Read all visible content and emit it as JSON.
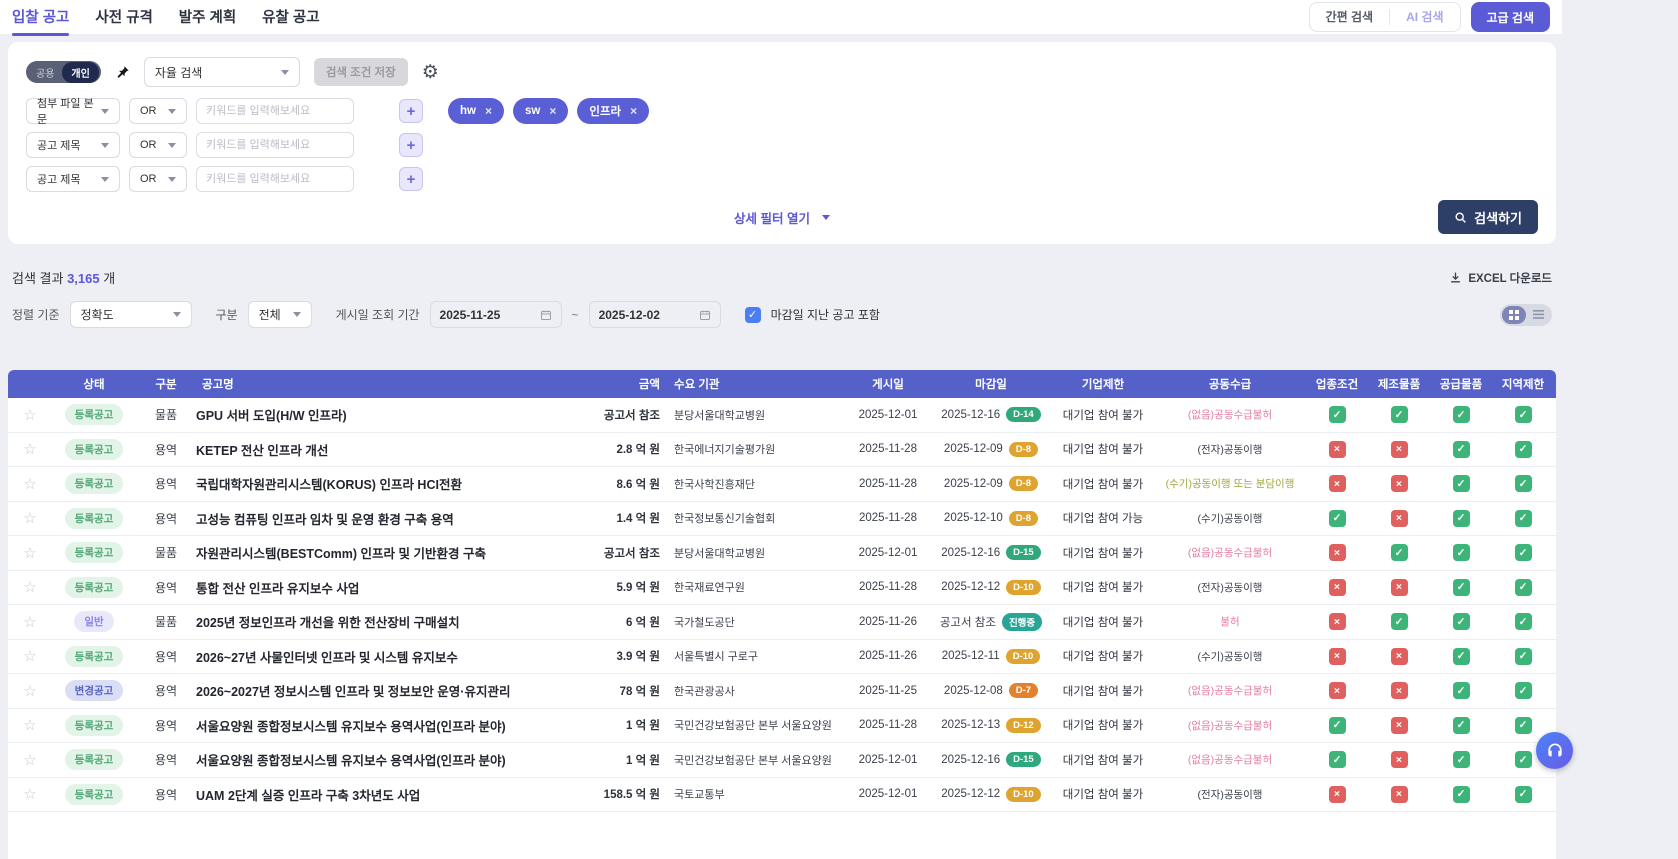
{
  "colors": {
    "accent_purple": "#5b5bd6",
    "table_header": "#5560c8",
    "navy_button": "#2d3f66",
    "flag_yes_green": "#3db578",
    "flag_no_red": "#e05f5f",
    "dday_green": "#2fa87c",
    "dday_amber": "#dfa32f",
    "dday_orange": "#e2822f",
    "dday_teal": "#27a596",
    "joint_pink": "#e77d9e",
    "joint_olive": "#a0a83c"
  },
  "nav": {
    "tabs": [
      {
        "label": "입찰 공고",
        "active": true
      },
      {
        "label": "사전 규격",
        "active": false
      },
      {
        "label": "발주 계획",
        "active": false
      },
      {
        "label": "유찰 공고",
        "active": false
      }
    ],
    "simple_search": "간편 검색",
    "ai_search": "AI 검색",
    "advanced_search": "고급 검색"
  },
  "search": {
    "scope_toggle": {
      "left": "공용",
      "right": "개인",
      "selected": "개인"
    },
    "preset_select": "자율 검색",
    "save_button": "검색 조건 저장",
    "rows": [
      {
        "field": "첨부 파일 본문",
        "operator": "OR",
        "placeholder": "키워드를 입력해보세요",
        "value": ""
      },
      {
        "field": "공고 제목",
        "operator": "OR",
        "placeholder": "키워드를 입력해보세요",
        "value": ""
      },
      {
        "field": "공고 제목",
        "operator": "OR",
        "placeholder": "키워드를 입력해보세요",
        "value": ""
      }
    ],
    "tags": [
      "hw",
      "sw",
      "인프라"
    ],
    "detail_filter_toggle": "상세 필터 열기",
    "search_button": "검색하기"
  },
  "results": {
    "count_prefix": "검색 결과",
    "count": "3,165",
    "count_suffix": "개",
    "excel_button": "EXCEL 다운로드",
    "sort_label": "정렬 기준",
    "sort_value": "정확도",
    "type_label": "구분",
    "type_value": "전체",
    "period_label": "게시일 조회 기간",
    "date_from": "2025-11-25",
    "date_separator": "~",
    "date_to": "2025-12-02",
    "include_expired_label": "마감일 지난 공고 포함",
    "include_expired_checked": true
  },
  "table": {
    "columns": [
      "상태",
      "구분",
      "공고명",
      "금액",
      "수요 기관",
      "게시일",
      "마감일",
      "기업제한",
      "공동수급",
      "업종조건",
      "제조물품",
      "공급물품",
      "지역제한"
    ],
    "rows": [
      {
        "status": "등록공고",
        "status_type": "reg",
        "category": "물품",
        "title": "GPU 서버 도입(H/W 인프라)",
        "amount": "공고서 참조",
        "org": "분당서울대학교병원",
        "posted": "2025-12-01",
        "deadline": "2025-12-16",
        "dday": "D-14",
        "dday_type": "green",
        "limit": "대기업 참여 불가",
        "joint": "(없음)공동수급불허",
        "joint_type": "pink",
        "flags": [
          true,
          true,
          true,
          true
        ]
      },
      {
        "status": "등록공고",
        "status_type": "reg",
        "category": "용역",
        "title": "KETEP 전산 인프라 개선",
        "amount": "2.8 억 원",
        "org": "한국에너지기술평가원",
        "posted": "2025-11-28",
        "deadline": "2025-12-09",
        "dday": "D-8",
        "dday_type": "amber",
        "limit": "대기업 참여 불가",
        "joint": "(전자)공동이행",
        "joint_type": "normal",
        "flags": [
          false,
          false,
          true,
          true
        ]
      },
      {
        "status": "등록공고",
        "status_type": "reg",
        "category": "용역",
        "title": "국립대학자원관리시스템(KORUS) 인프라 HCI전환",
        "amount": "8.6 억 원",
        "org": "한국사학진흥재단",
        "posted": "2025-11-28",
        "deadline": "2025-12-09",
        "dday": "D-8",
        "dday_type": "amber",
        "limit": "대기업 참여 불가",
        "joint": "(수기)공동이행 또는 분담이행",
        "joint_type": "olive",
        "flags": [
          false,
          false,
          true,
          true
        ]
      },
      {
        "status": "등록공고",
        "status_type": "reg",
        "category": "용역",
        "title": "고성능 컴퓨팅 인프라 임차 및 운영 환경 구축 용역",
        "amount": "1.4 억 원",
        "org": "한국정보통신기술협회",
        "posted": "2025-11-28",
        "deadline": "2025-12-10",
        "dday": "D-8",
        "dday_type": "amber",
        "limit": "대기업 참여 가능",
        "joint": "(수기)공동이행",
        "joint_type": "normal",
        "flags": [
          true,
          false,
          true,
          true
        ]
      },
      {
        "status": "등록공고",
        "status_type": "reg",
        "category": "물품",
        "title": "자원관리시스템(BESTComm) 인프라 및 기반환경 구축",
        "amount": "공고서 참조",
        "org": "분당서울대학교병원",
        "posted": "2025-12-01",
        "deadline": "2025-12-16",
        "dday": "D-15",
        "dday_type": "green",
        "limit": "대기업 참여 불가",
        "joint": "(없음)공동수급불허",
        "joint_type": "pink",
        "flags": [
          false,
          true,
          true,
          true
        ]
      },
      {
        "status": "등록공고",
        "status_type": "reg",
        "category": "용역",
        "title": "통합 전산 인프라 유지보수 사업",
        "amount": "5.9 억 원",
        "org": "한국재료연구원",
        "posted": "2025-11-28",
        "deadline": "2025-12-12",
        "dday": "D-10",
        "dday_type": "amber",
        "limit": "대기업 참여 불가",
        "joint": "(전자)공동이행",
        "joint_type": "normal",
        "flags": [
          false,
          false,
          true,
          true
        ]
      },
      {
        "status": "일반",
        "status_type": "general",
        "category": "물품",
        "title": "2025년 정보인프라 개선을 위한 전산장비 구매설치",
        "amount": "6 억 원",
        "org": "국가철도공단",
        "posted": "2025-11-26",
        "deadline": "공고서 참조",
        "dday": "진행중",
        "dday_type": "teal",
        "limit": "대기업 참여 불가",
        "joint": "불허",
        "joint_type": "pink",
        "flags": [
          false,
          true,
          true,
          true
        ]
      },
      {
        "status": "등록공고",
        "status_type": "reg",
        "category": "용역",
        "title": "2026~27년 사물인터넷 인프라 및 시스템 유지보수",
        "amount": "3.9 억 원",
        "org": "서울특별시 구로구",
        "posted": "2025-11-26",
        "deadline": "2025-12-11",
        "dday": "D-10",
        "dday_type": "amber",
        "limit": "대기업 참여 불가",
        "joint": "(수기)공동이행",
        "joint_type": "normal",
        "flags": [
          false,
          false,
          true,
          true
        ]
      },
      {
        "status": "변경공고",
        "status_type": "changed",
        "category": "용역",
        "title": "2026~2027년 정보시스템 인프라 및 정보보안 운영·유지관리",
        "amount": "78 억 원",
        "org": "한국관광공사",
        "posted": "2025-11-25",
        "deadline": "2025-12-08",
        "dday": "D-7",
        "dday_type": "orange",
        "limit": "대기업 참여 불가",
        "joint": "(없음)공동수급불허",
        "joint_type": "pink",
        "flags": [
          false,
          false,
          true,
          true
        ]
      },
      {
        "status": "등록공고",
        "status_type": "reg",
        "category": "용역",
        "title": "서울요양원 종합정보시스템 유지보수 용역사업(인프라 분야)",
        "amount": "1 억 원",
        "org": "국민건강보험공단 본부 서울요양원",
        "posted": "2025-11-28",
        "deadline": "2025-12-13",
        "dday": "D-12",
        "dday_type": "amber",
        "limit": "대기업 참여 불가",
        "joint": "(없음)공동수급불허",
        "joint_type": "pink",
        "flags": [
          true,
          false,
          true,
          true
        ]
      },
      {
        "status": "등록공고",
        "status_type": "reg",
        "category": "용역",
        "title": "서울요양원 종합정보시스템 유지보수 용역사업(인프라 분야)",
        "amount": "1 억 원",
        "org": "국민건강보험공단 본부 서울요양원",
        "posted": "2025-12-01",
        "deadline": "2025-12-16",
        "dday": "D-15",
        "dday_type": "green",
        "limit": "대기업 참여 불가",
        "joint": "(없음)공동수급불허",
        "joint_type": "pink",
        "flags": [
          true,
          false,
          true,
          true
        ]
      },
      {
        "status": "등록공고",
        "status_type": "reg",
        "category": "용역",
        "title": "UAM 2단계 실증 인프라 구축 3차년도 사업",
        "amount": "158.5 억 원",
        "org": "국토교통부",
        "posted": "2025-12-01",
        "deadline": "2025-12-12",
        "dday": "D-10",
        "dday_type": "amber",
        "limit": "대기업 참여 불가",
        "joint": "(전자)공동이행",
        "joint_type": "normal",
        "flags": [
          false,
          false,
          true,
          true
        ]
      }
    ]
  }
}
